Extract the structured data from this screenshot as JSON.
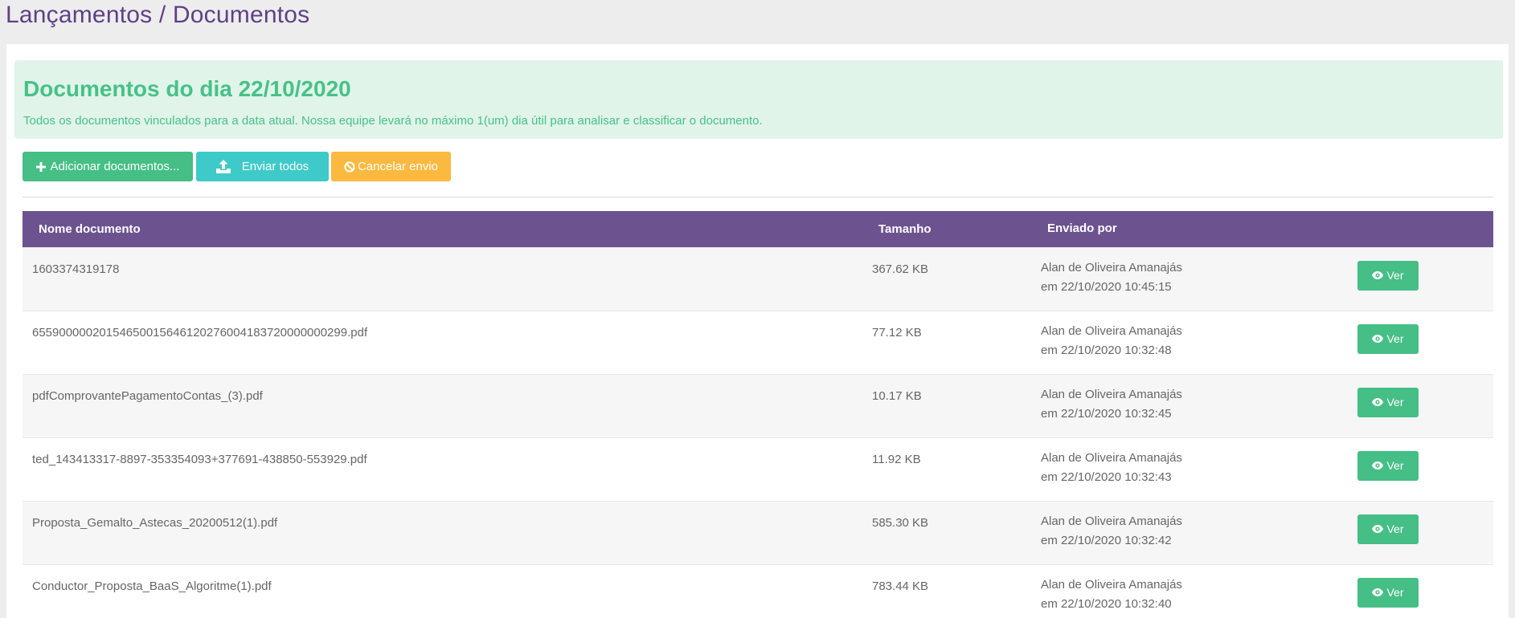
{
  "page": {
    "title": "Lançamentos / Documentos"
  },
  "alert": {
    "title": "Documentos do dia 22/10/2020",
    "text": "Todos os documentos vinculados para a data atual. Nossa equipe levará no máximo 1(um) dia útil para analisar e classificar o documento."
  },
  "toolbar": {
    "add_label": "Adicionar documentos...",
    "send_label": "Enviar todos",
    "cancel_label": "Cancelar envio"
  },
  "table": {
    "headers": {
      "name": "Nome documento",
      "size": "Tamanho",
      "sent_by": "Enviado por"
    },
    "view_label": "Ver",
    "rows": [
      {
        "name": "1603374319178",
        "size": "367.62 KB",
        "user": "Alan de Oliveira Amanajás",
        "date": "em 22/10/2020 10:45:15"
      },
      {
        "name": "65590000020154650015646120276004183720000000299.pdf",
        "size": "77.12 KB",
        "user": "Alan de Oliveira Amanajás",
        "date": "em 22/10/2020 10:32:48"
      },
      {
        "name": "pdfComprovantePagamentoContas_(3).pdf",
        "size": "10.17 KB",
        "user": "Alan de Oliveira Amanajás",
        "date": "em 22/10/2020 10:32:45"
      },
      {
        "name": "ted_143413317-8897-353354093+377691-438850-553929.pdf",
        "size": "11.92 KB",
        "user": "Alan de Oliveira Amanajás",
        "date": "em 22/10/2020 10:32:43"
      },
      {
        "name": "Proposta_Gemalto_Astecas_20200512(1).pdf",
        "size": "585.30 KB",
        "user": "Alan de Oliveira Amanajás",
        "date": "em 22/10/2020 10:32:42"
      },
      {
        "name": "Conductor_Proposta_BaaS_Algoritme(1).pdf",
        "size": "783.44 KB",
        "user": "Alan de Oliveira Amanajás",
        "date": "em 22/10/2020 10:32:40"
      }
    ]
  },
  "colors": {
    "title": "#5e4185",
    "header_bg": "#6d5290",
    "success": "#45bf85",
    "info": "#3ecac8",
    "warning": "#fbb93f",
    "alert_bg": "#e0f4ea"
  },
  "icons": {
    "add": "plus-icon",
    "send": "upload-icon",
    "cancel": "ban-icon",
    "view": "eye-icon"
  }
}
